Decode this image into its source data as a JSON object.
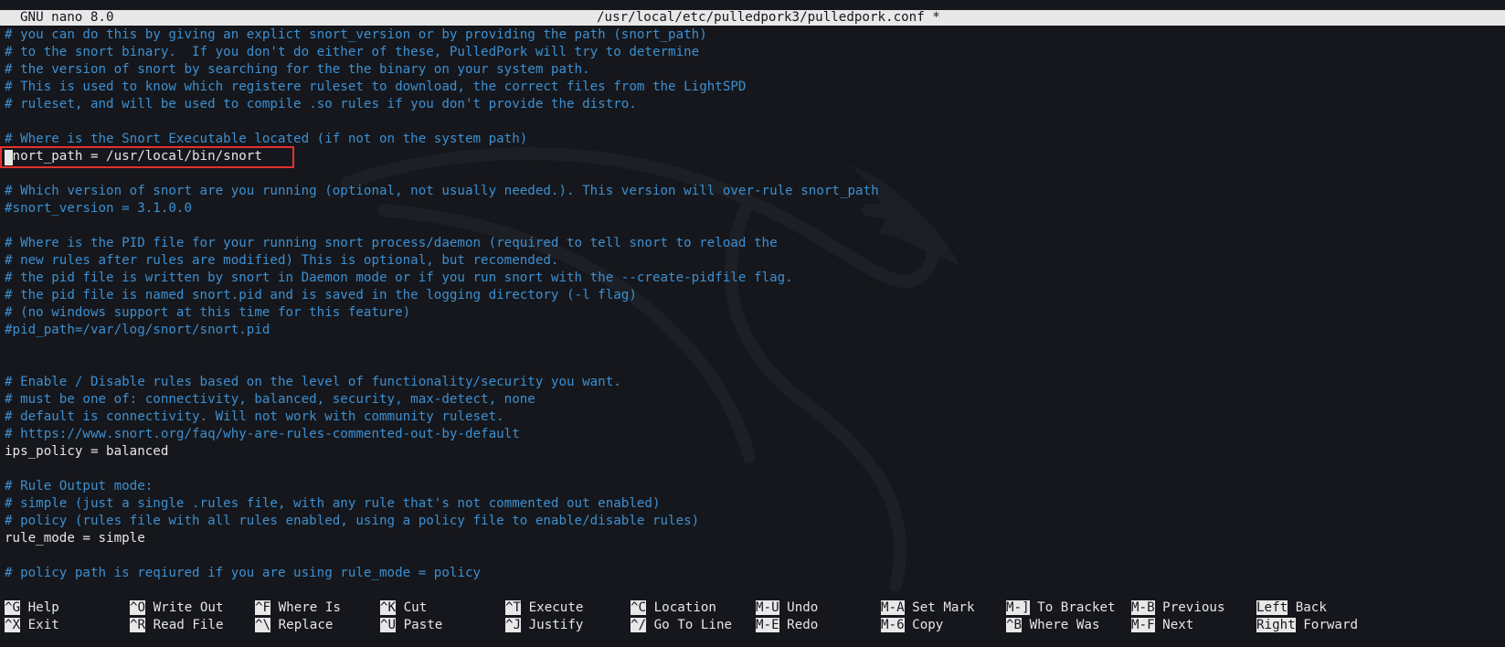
{
  "titlebar": {
    "app": "GNU nano 8.0",
    "file": "/usr/local/etc/pulledpork3/pulledpork.conf *"
  },
  "lines": [
    {
      "type": "comment",
      "text": "# you can do this by giving an explict snort_version or by providing the path (snort_path)"
    },
    {
      "type": "comment",
      "text": "# to the snort binary.  If you don't do either of these, PulledPork will try to determine"
    },
    {
      "type": "comment",
      "text": "# the version of snort by searching for the the binary on your system path."
    },
    {
      "type": "comment",
      "text": "# This is used to know which registere ruleset to download, the correct files from the LightSPD"
    },
    {
      "type": "comment",
      "text": "# ruleset, and will be used to compile .so rules if you don't provide the distro."
    },
    {
      "type": "blank",
      "text": ""
    },
    {
      "type": "comment",
      "text": "# Where is the Snort Executable located (if not on the system path)"
    },
    {
      "type": "code",
      "text": "snort_path = /usr/local/bin/snort"
    },
    {
      "type": "blank",
      "text": ""
    },
    {
      "type": "comment",
      "text": "# Which version of snort are you running (optional, not usually needed.). This version will over-rule snort_path"
    },
    {
      "type": "comment",
      "text": "#snort_version = 3.1.0.0"
    },
    {
      "type": "blank",
      "text": ""
    },
    {
      "type": "comment",
      "text": "# Where is the PID file for your running snort process/daemon (required to tell snort to reload the"
    },
    {
      "type": "comment",
      "text": "# new rules after rules are modified) This is optional, but recomended."
    },
    {
      "type": "comment",
      "text": "# the pid file is written by snort in Daemon mode or if you run snort with the --create-pidfile flag."
    },
    {
      "type": "comment",
      "text": "# the pid file is named snort.pid and is saved in the logging directory (-l flag)"
    },
    {
      "type": "comment",
      "text": "# (no windows support at this time for this feature)"
    },
    {
      "type": "comment",
      "text": "#pid_path=/var/log/snort/snort.pid"
    },
    {
      "type": "blank",
      "text": ""
    },
    {
      "type": "blank",
      "text": ""
    },
    {
      "type": "comment",
      "text": "# Enable / Disable rules based on the level of functionality/security you want."
    },
    {
      "type": "comment",
      "text": "# must be one of: connectivity, balanced, security, max-detect, none"
    },
    {
      "type": "comment",
      "text": "# default is connectivity. Will not work with community ruleset."
    },
    {
      "type": "comment",
      "text": "# https://www.snort.org/faq/why-are-rules-commented-out-by-default"
    },
    {
      "type": "code",
      "text": "ips_policy = balanced"
    },
    {
      "type": "blank",
      "text": ""
    },
    {
      "type": "comment",
      "text": "# Rule Output mode:"
    },
    {
      "type": "comment",
      "text": "# simple (just a single .rules file, with any rule that's not commented out enabled)"
    },
    {
      "type": "comment",
      "text": "# policy (rules file with all rules enabled, using a policy file to enable/disable rules)"
    },
    {
      "type": "code",
      "text": "rule_mode = simple"
    },
    {
      "type": "blank",
      "text": ""
    },
    {
      "type": "comment",
      "text": "# policy path is reqiured if you are using rule_mode = policy"
    }
  ],
  "shortcuts": [
    {
      "key": "^G",
      "label": "Help"
    },
    {
      "key": "^X",
      "label": "Exit"
    },
    {
      "key": "^O",
      "label": "Write Out"
    },
    {
      "key": "^R",
      "label": "Read File"
    },
    {
      "key": "^F",
      "label": "Where Is"
    },
    {
      "key": "^\\",
      "label": "Replace"
    },
    {
      "key": "^K",
      "label": "Cut"
    },
    {
      "key": "^U",
      "label": "Paste"
    },
    {
      "key": "^T",
      "label": "Execute"
    },
    {
      "key": "^J",
      "label": "Justify"
    },
    {
      "key": "^C",
      "label": "Location"
    },
    {
      "key": "^/",
      "label": "Go To Line"
    },
    {
      "key": "M-U",
      "label": "Undo"
    },
    {
      "key": "M-E",
      "label": "Redo"
    },
    {
      "key": "M-A",
      "label": "Set Mark"
    },
    {
      "key": "M-6",
      "label": "Copy"
    },
    {
      "key": "M-]",
      "label": "To Bracket"
    },
    {
      "key": "^B",
      "label": "Where Was"
    },
    {
      "key": "M-B",
      "label": "Previous"
    },
    {
      "key": "M-F",
      "label": "Next"
    },
    {
      "key": "Left",
      "label": "Back"
    },
    {
      "key": "Right",
      "label": "Forward"
    }
  ],
  "colors": {
    "background": "#15171c",
    "comment": "#3d8fd1",
    "text": "#e6e6e6",
    "highlight_box": "#e5312e",
    "bar": "#e8e8e8"
  }
}
